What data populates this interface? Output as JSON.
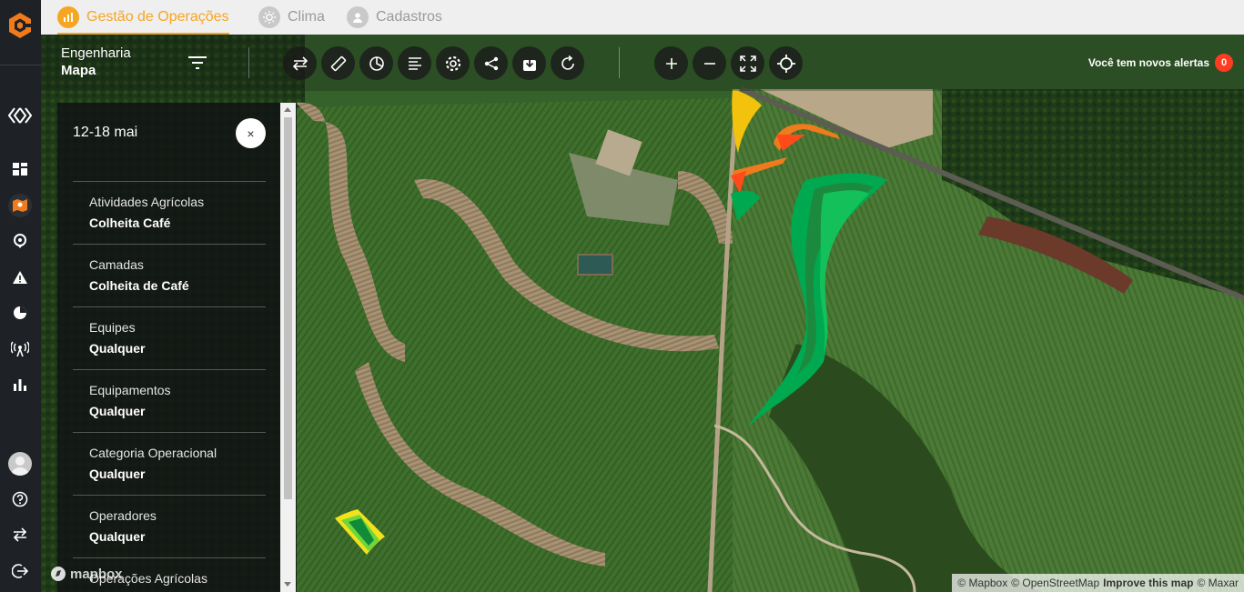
{
  "rail": {
    "items": [
      {
        "name": "dashboard-icon"
      },
      {
        "name": "map-icon",
        "active": true
      },
      {
        "name": "rocket-icon"
      },
      {
        "name": "alert-icon"
      },
      {
        "name": "pie-chart-icon"
      },
      {
        "name": "antenna-icon"
      },
      {
        "name": "bar-chart-icon"
      }
    ],
    "bottom": [
      {
        "name": "help-icon"
      },
      {
        "name": "swap-icon"
      },
      {
        "name": "logout-icon"
      }
    ]
  },
  "tabs": [
    {
      "label": "Gestão de Operações",
      "icon": "chart-icon",
      "active": true
    },
    {
      "label": "Clima",
      "icon": "sun-icon",
      "active": false
    },
    {
      "label": "Cadastros",
      "icon": "person-icon",
      "active": false
    }
  ],
  "context": {
    "line1": "Engenharia",
    "line2": "Mapa"
  },
  "toolbar": {
    "tools": [
      "swap-arrows-icon",
      "ruler-icon",
      "clock-pie-icon",
      "list-icon",
      "gear-icon",
      "share-icon",
      "download-icon",
      "refresh-icon"
    ],
    "zoom": [
      "zoom-in-icon",
      "zoom-out-icon",
      "fit-screen-icon",
      "locate-icon"
    ]
  },
  "alerts": {
    "label": "Você tem novos alertas",
    "count": "0"
  },
  "panel": {
    "date": "12-18 mai",
    "close_label": "×",
    "filters": [
      {
        "label": "Atividades Agrícolas",
        "value": "Colheita Café"
      },
      {
        "label": "Camadas",
        "value": "Colheita de Café"
      },
      {
        "label": "Equipes",
        "value": "Qualquer"
      },
      {
        "label": "Equipamentos",
        "value": "Qualquer"
      },
      {
        "label": "Categoria Operacional",
        "value": "Qualquer"
      },
      {
        "label": "Operadores",
        "value": "Qualquer"
      },
      {
        "label": "Operações Agrícolas",
        "value": ""
      }
    ]
  },
  "mapbox_logo": "mapbox",
  "attribution": {
    "mapbox": "© Mapbox",
    "osm": "© OpenStreetMap",
    "improve": "Improve this map",
    "maxar": "© Maxar"
  },
  "colors": {
    "accent": "#f5a623",
    "badge": "#ff3b21",
    "harvest_green": "#00a84f",
    "harvest_orange": "#f07b1d",
    "harvest_yellow": "#f2c20c"
  }
}
